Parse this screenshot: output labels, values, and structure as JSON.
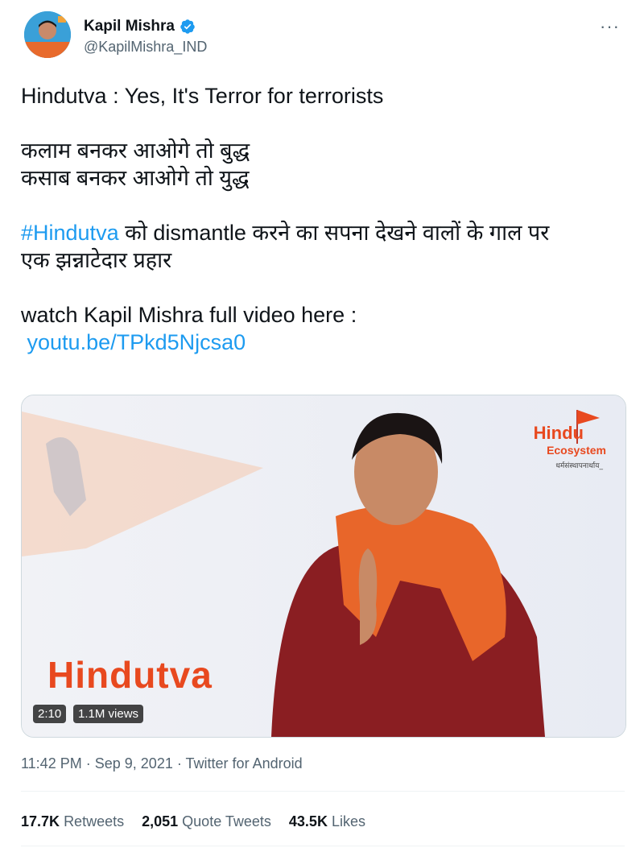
{
  "author": {
    "name": "Kapil Mishra",
    "handle": "@KapilMishra_IND",
    "verified": true
  },
  "tweet": {
    "line1": "Hindutva : Yes, It's Terror for terrorists",
    "line2": "कलाम बनकर आओगे तो बुद्ध",
    "line3": "कसाब बनकर आओगे तो युद्ध",
    "hashtag": "#Hindutva",
    "line4_rest": " को dismantle करने का सपना देखने वालों के गाल पर",
    "line5": "एक झन्नाटेदार प्रहार",
    "line6": "watch Kapil Mishra full video here :",
    "link": "youtu.be/TPkd5Njcsa0"
  },
  "media": {
    "title": "Hindutva",
    "duration": "2:10",
    "views": "1.1M views",
    "logo_line1": "Hindu",
    "logo_line2": "Ecosystem",
    "logo_tagline": "धर्मसंस्थापनार्थाय_"
  },
  "meta": {
    "time": "11:42 PM",
    "date": "Sep 9, 2021",
    "source": "Twitter for Android",
    "dot": "·"
  },
  "stats": {
    "retweets_count": "17.7K",
    "retweets_label": "Retweets",
    "quotes_count": "2,051",
    "quotes_label": "Quote Tweets",
    "likes_count": "43.5K",
    "likes_label": "Likes"
  },
  "more_icon": "···",
  "colors": {
    "link": "#1d9bf0",
    "accent_orange": "#e8491f",
    "muted": "#536471"
  }
}
